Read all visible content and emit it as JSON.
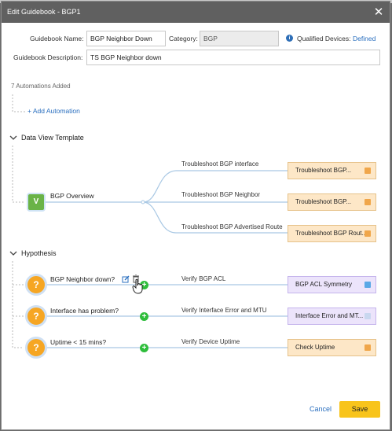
{
  "window": {
    "title": "Edit Guidebook - BGP1",
    "close_glyph": "✕"
  },
  "form": {
    "name_label": "Guidebook Name:",
    "name_value": "BGP Neighbor Down",
    "category_label": "Category:",
    "category_value": "BGP",
    "qualified_label": "Qualified Devices:",
    "qualified_link": "Defined",
    "description_label": "Guidebook Description:",
    "description_value": "TS BGP Neighbor down"
  },
  "automations": {
    "count_text": "7 Automations Added",
    "add_link": "+ Add Automation"
  },
  "data_view": {
    "title": "Data View Template",
    "node_badge": "V",
    "node_label": "BGP Overview",
    "branches": [
      {
        "edge": "Troubleshoot BGP interface",
        "card": "Troubleshoot BGP..."
      },
      {
        "edge": "Troubleshoot BGP Neighbor",
        "card": "Troubleshoot BGP..."
      },
      {
        "edge": "Troubleshoot BGP Advertised Route",
        "card": "Troubleshoot BGP Rout..."
      }
    ]
  },
  "hypothesis": {
    "title": "Hypothesis",
    "badge": "?",
    "items": [
      {
        "label": "BGP Neighbor down?",
        "edge": "Verify BGP ACL",
        "card": "BGP ACL Symmetry",
        "card_style": "purple"
      },
      {
        "label": "Interface has problem?",
        "edge": "Verify Interface Error and MTU",
        "card": "Interface Error and MT...",
        "card_style": "purple"
      },
      {
        "label": "Uptime < 15 mins?",
        "edge": "Verify Device Uptime",
        "card": "Check Uptime",
        "card_style": "orange"
      }
    ]
  },
  "footer": {
    "cancel": "Cancel",
    "save": "Save"
  },
  "colors": {
    "accent": "#2a6fbf",
    "save": "#f8c41b",
    "title_bar": "#606060",
    "success": "#2ebd3b",
    "warning": "#f6a623"
  }
}
